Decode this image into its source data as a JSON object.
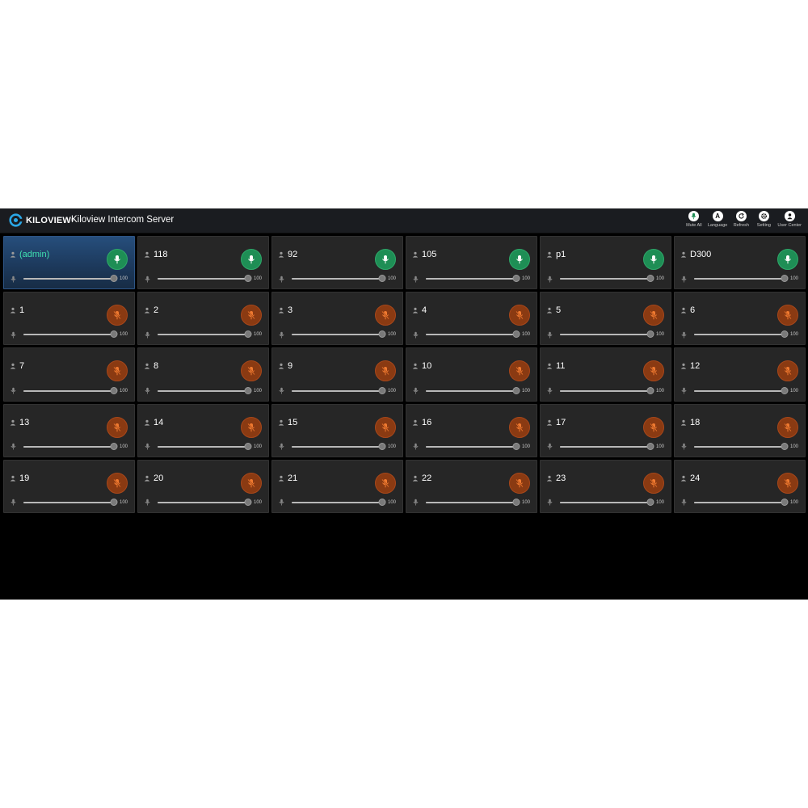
{
  "header": {
    "logo_text": "KILOVIEW",
    "logo_mark": "®",
    "title": "Kiloview Intercom Server",
    "toolbar": [
      {
        "key": "mute_all",
        "label": "Mute All",
        "icon": "mic-icon",
        "glyph": ""
      },
      {
        "key": "language",
        "label": "Language",
        "icon": "language-icon",
        "glyph": "A"
      },
      {
        "key": "refresh",
        "label": "Refresh",
        "icon": "refresh-icon",
        "glyph": ""
      },
      {
        "key": "setting",
        "label": "Setting",
        "icon": "gear-icon",
        "glyph": ""
      },
      {
        "key": "user_center",
        "label": "User Center",
        "icon": "user-icon",
        "glyph": ""
      }
    ]
  },
  "colors": {
    "mic_on": "#1e8e55",
    "mic_off": "#8a3a12",
    "admin_name": "#3fe0b0",
    "admin_card": "#264e7c"
  },
  "users": [
    {
      "name": "(admin)",
      "mic": "on",
      "volume": 100,
      "admin": true
    },
    {
      "name": "118",
      "mic": "on",
      "volume": 100
    },
    {
      "name": "92",
      "mic": "on",
      "volume": 100
    },
    {
      "name": "105",
      "mic": "on",
      "volume": 100
    },
    {
      "name": "p1",
      "mic": "on",
      "volume": 100
    },
    {
      "name": "D300",
      "mic": "on",
      "volume": 100
    },
    {
      "name": "1",
      "mic": "off",
      "volume": 100
    },
    {
      "name": "2",
      "mic": "off",
      "volume": 100
    },
    {
      "name": "3",
      "mic": "off",
      "volume": 100
    },
    {
      "name": "4",
      "mic": "off",
      "volume": 100
    },
    {
      "name": "5",
      "mic": "off",
      "volume": 100
    },
    {
      "name": "6",
      "mic": "off",
      "volume": 100
    },
    {
      "name": "7",
      "mic": "off",
      "volume": 100
    },
    {
      "name": "8",
      "mic": "off",
      "volume": 100
    },
    {
      "name": "9",
      "mic": "off",
      "volume": 100
    },
    {
      "name": "10",
      "mic": "off",
      "volume": 100
    },
    {
      "name": "11",
      "mic": "off",
      "volume": 100
    },
    {
      "name": "12",
      "mic": "off",
      "volume": 100
    },
    {
      "name": "13",
      "mic": "off",
      "volume": 100
    },
    {
      "name": "14",
      "mic": "off",
      "volume": 100
    },
    {
      "name": "15",
      "mic": "off",
      "volume": 100
    },
    {
      "name": "16",
      "mic": "off",
      "volume": 100
    },
    {
      "name": "17",
      "mic": "off",
      "volume": 100
    },
    {
      "name": "18",
      "mic": "off",
      "volume": 100
    },
    {
      "name": "19",
      "mic": "off",
      "volume": 100
    },
    {
      "name": "20",
      "mic": "off",
      "volume": 100
    },
    {
      "name": "21",
      "mic": "off",
      "volume": 100
    },
    {
      "name": "22",
      "mic": "off",
      "volume": 100
    },
    {
      "name": "23",
      "mic": "off",
      "volume": 100
    },
    {
      "name": "24",
      "mic": "off",
      "volume": 100
    }
  ]
}
